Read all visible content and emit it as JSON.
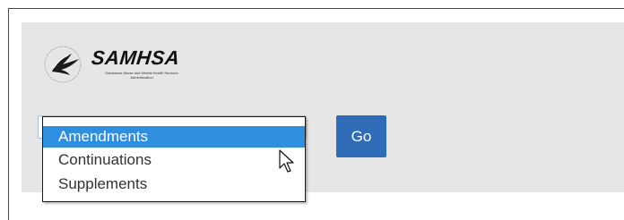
{
  "logo": {
    "name": "SAMHSA",
    "subtitle": "Substance Abuse and Mental Health Services Administration"
  },
  "dropdown": {
    "options": [
      {
        "label": "Amendments",
        "selected": true
      },
      {
        "label": "Continuations",
        "selected": false
      },
      {
        "label": "Supplements",
        "selected": false
      }
    ]
  },
  "go_button": {
    "label": "Go"
  },
  "colors": {
    "panel_bg": "#e6e6e6",
    "selected_option_bg": "#2f8ee0",
    "go_button_bg": "#2f6db8"
  },
  "icons": {
    "cursor": "arrow-cursor-icon",
    "logo_mark": "hhs-eagle-icon"
  }
}
